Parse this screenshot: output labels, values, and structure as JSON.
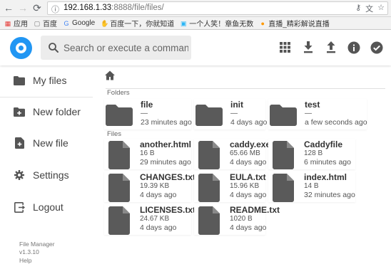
{
  "browser": {
    "url_host": "192.168.1.33",
    "url_path": ":8888/file/files/",
    "bookmarks": [
      {
        "label": "应用",
        "icon": "apps-grid-icon",
        "color": "#e53935"
      },
      {
        "label": "百度",
        "icon": "page-icon",
        "color": "#777777"
      },
      {
        "label": "Google",
        "icon": "google-icon",
        "color": "#4285f4"
      },
      {
        "label": "百度一下，你就知道",
        "icon": "baidu-paw-icon",
        "color": "#2932e1"
      },
      {
        "label": "一个人笑！章鱼无数",
        "icon": "bookmark-icon",
        "color": "#29b6f6"
      },
      {
        "label": "直播_精彩解说直播",
        "icon": "live-icon",
        "color": "#ff9800"
      }
    ]
  },
  "header": {
    "search_placeholder": "Search or execute a command...",
    "actions": [
      "grid-view-icon",
      "download-icon",
      "upload-icon",
      "info-icon",
      "check-icon"
    ],
    "accent": "#2196f3"
  },
  "sidebar": {
    "items": [
      {
        "label": "My files",
        "icon": "folder-icon"
      },
      {
        "label": "New folder",
        "icon": "new-folder-icon"
      },
      {
        "label": "New file",
        "icon": "new-file-icon"
      },
      {
        "label": "Settings",
        "icon": "gear-icon"
      },
      {
        "label": "Logout",
        "icon": "logout-icon"
      }
    ],
    "footer": {
      "app_name": "File Manager",
      "version": "v1.3.10",
      "help": "Help"
    }
  },
  "main": {
    "folders_title": "Folders",
    "files_title": "Files",
    "folders": [
      {
        "name": "file",
        "size": "—",
        "modified": "23 minutes ago"
      },
      {
        "name": "init",
        "size": "—",
        "modified": "4 days ago"
      },
      {
        "name": "test",
        "size": "—",
        "modified": "a few seconds ago"
      }
    ],
    "files": [
      {
        "name": "another.html",
        "size": "16 B",
        "modified": "29 minutes ago"
      },
      {
        "name": "caddy.exe",
        "size": "65.66 MB",
        "modified": "4 days ago"
      },
      {
        "name": "Caddyfile",
        "size": "128 B",
        "modified": "6 minutes ago"
      },
      {
        "name": "CHANGES.txt",
        "size": "19.39 KB",
        "modified": "4 days ago"
      },
      {
        "name": "EULA.txt",
        "size": "15.96 KB",
        "modified": "4 days ago"
      },
      {
        "name": "index.html",
        "size": "14 B",
        "modified": "32 minutes ago"
      },
      {
        "name": "LICENSES.txt",
        "size": "24.67 KB",
        "modified": "4 days ago"
      },
      {
        "name": "README.txt",
        "size": "1020 B",
        "modified": "4 days ago"
      }
    ]
  }
}
